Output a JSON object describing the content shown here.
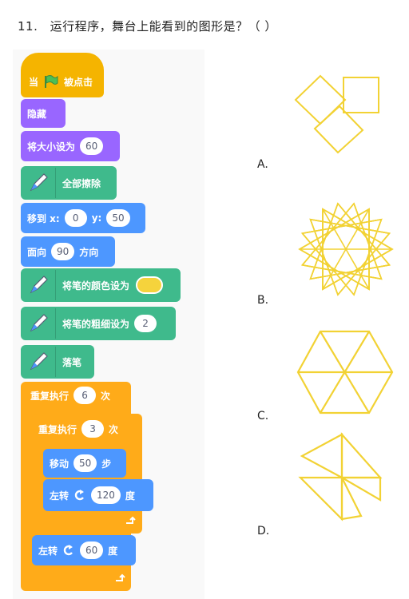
{
  "question": {
    "number": "11.",
    "text": "运行程序，舞台上能看到的图形是？（   ）"
  },
  "blocks": {
    "hat": {
      "prefix": "当",
      "suffix": "被点击"
    },
    "hide": "隐藏",
    "size": {
      "label": "将大小设为",
      "value": "60"
    },
    "clear": "全部擦除",
    "goto": {
      "label": "移到 x:",
      "x": "0",
      "ylabel": "y:",
      "y": "50"
    },
    "direction": {
      "label": "面向",
      "value": "90",
      "suffix": "方向"
    },
    "pen_color": "将笔的颜色设为",
    "pen_size": {
      "label": "将笔的粗细设为",
      "value": "2"
    },
    "pen_down": "落笔",
    "repeat_outer": {
      "label": "重复执行",
      "value": "6",
      "suffix": "次"
    },
    "repeat_inner": {
      "label": "重复执行",
      "value": "3",
      "suffix": "次"
    },
    "move": {
      "label": "移动",
      "value": "50",
      "suffix": "步"
    },
    "turn_inner": {
      "label": "左转",
      "value": "120",
      "suffix": "度"
    },
    "turn_outer": {
      "label": "左转",
      "value": "60",
      "suffix": "度"
    }
  },
  "options": [
    "A.",
    "B.",
    "C.",
    "D."
  ],
  "colors": {
    "events": "#f5b400",
    "looks": "#9966ff",
    "motion": "#4d97ff",
    "pen": "#3fba8c",
    "control": "#ffab19",
    "stroke": "#f2d234",
    "flag": "#4cbf56"
  },
  "icons": [
    "green-flag-icon",
    "pen-icon",
    "rotate-left-icon",
    "loop-arrow-icon"
  ]
}
